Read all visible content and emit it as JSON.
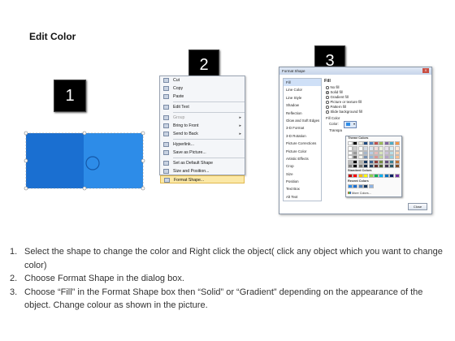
{
  "title": "Edit Color",
  "step_badges": [
    "1",
    "2",
    "3"
  ],
  "puzzle": {
    "left_color": "#1a6fd1",
    "right_color": "#2d8ce8",
    "selection_color": "#8a8a8a"
  },
  "context_menu": {
    "items": [
      {
        "label": "Cut",
        "icon": "scissors-icon",
        "submenu": false,
        "disabled": false
      },
      {
        "label": "Copy",
        "icon": "copy-icon",
        "submenu": false,
        "disabled": false
      },
      {
        "label": "Paste",
        "icon": "paste-icon",
        "submenu": false,
        "disabled": false
      },
      {
        "label": "Edit Text",
        "icon": "edit-text-icon",
        "submenu": false,
        "disabled": false
      },
      {
        "label": "Group",
        "icon": "group-icon",
        "submenu": true,
        "disabled": true
      },
      {
        "label": "Bring to Front",
        "icon": "bring-front-icon",
        "submenu": true,
        "disabled": false
      },
      {
        "label": "Send to Back",
        "icon": "send-back-icon",
        "submenu": true,
        "disabled": false
      },
      {
        "label": "Hyperlink...",
        "icon": "hyperlink-icon",
        "submenu": false,
        "disabled": false
      },
      {
        "label": "Save as Picture...",
        "icon": "save-picture-icon",
        "submenu": false,
        "disabled": false
      },
      {
        "label": "Set as Default Shape",
        "icon": "default-shape-icon",
        "submenu": false,
        "disabled": false
      },
      {
        "label": "Size and Position...",
        "icon": "size-position-icon",
        "submenu": false,
        "disabled": false
      },
      {
        "label": "Format Shape...",
        "icon": "format-shape-icon",
        "submenu": false,
        "disabled": false,
        "highlighted": true
      }
    ]
  },
  "format_dialog": {
    "title": "Format Shape",
    "close_label": "X",
    "sidebar": [
      "Fill",
      "Line Color",
      "Line Style",
      "Shadow",
      "Reflection",
      "Glow and Soft Edges",
      "3-D Format",
      "3-D Rotation",
      "Picture Corrections",
      "Picture Color",
      "Artistic Effects",
      "Crop",
      "Size",
      "Position",
      "Text Box",
      "Alt Text"
    ],
    "selected_sidebar": "Fill",
    "section_title": "Fill",
    "fill_options": [
      {
        "label": "No fill",
        "selected": false
      },
      {
        "label": "Solid fill",
        "selected": true
      },
      {
        "label": "Gradient fill",
        "selected": false
      },
      {
        "label": "Picture or texture fill",
        "selected": false
      },
      {
        "label": "Pattern fill",
        "selected": false
      },
      {
        "label": "Slide background fill",
        "selected": false
      }
    ],
    "fill_color_label": "Fill Color",
    "color_label": "Color:",
    "transparency_label": "Transpa",
    "close_button": "Close"
  },
  "color_popup": {
    "theme_colors_label": "Theme Colors",
    "standard_colors_label": "Standard Colors",
    "recent_colors_label": "Recent Colors",
    "more_colors_label": "More Colors...",
    "theme_top_row": [
      "#ffffff",
      "#000000",
      "#eeece1",
      "#1f497d",
      "#4f81bd",
      "#c0504d",
      "#9bbb59",
      "#8064a2",
      "#4bacc6",
      "#f79646"
    ],
    "standard_colors": [
      "#c00000",
      "#ff0000",
      "#ffc000",
      "#ffff00",
      "#92d050",
      "#00b050",
      "#00b0f0",
      "#0070c0",
      "#002060",
      "#7030a0"
    ],
    "recent_colors": [
      "#2d8ce8",
      "#1a6fd1",
      "#4f81bd",
      "#17375e",
      "#8db3e2"
    ]
  },
  "steps": [
    {
      "num": "1.",
      "text": "Select the shape to change the color and Right click the object( click any object which you want to change color)"
    },
    {
      "num": "2.",
      "text": "Choose Format Shape in the dialog box."
    },
    {
      "num": "3.",
      "text": "Choose “Fill” in the Format Shape box then “Solid” or “Gradient” depending on the appearance of the object. Change colour as shown in the picture."
    }
  ]
}
